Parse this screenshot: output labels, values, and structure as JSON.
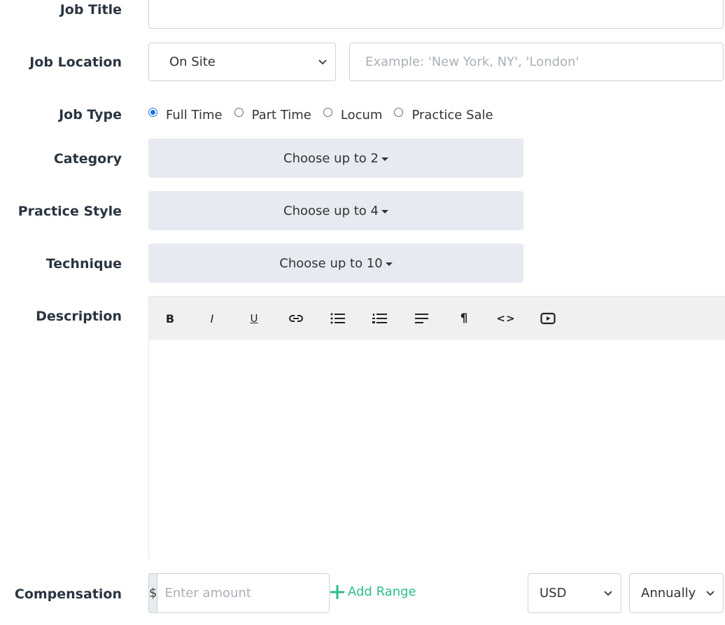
{
  "form": {
    "job_title": {
      "label": "Job Title",
      "value": ""
    },
    "job_location": {
      "label": "Job Location",
      "select_value": "On Site",
      "placeholder": "Example: 'New York, NY', 'London'"
    },
    "job_type": {
      "label": "Job Type",
      "options": [
        {
          "label": "Full Time",
          "checked": true
        },
        {
          "label": "Part Time",
          "checked": false
        },
        {
          "label": "Locum",
          "checked": false
        },
        {
          "label": "Practice Sale",
          "checked": false
        }
      ]
    },
    "category": {
      "label": "Category",
      "button": "Choose up to 2"
    },
    "practice_style": {
      "label": "Practice Style",
      "button": "Choose up to 4"
    },
    "technique": {
      "label": "Technique",
      "button": "Choose up to 10"
    },
    "description": {
      "label": "Description",
      "toolbar": [
        {
          "name": "bold",
          "icon": "bold-icon",
          "glyph": "B"
        },
        {
          "name": "italic",
          "icon": "italic-icon",
          "glyph": "I"
        },
        {
          "name": "underline",
          "icon": "underline-icon",
          "glyph": "U"
        },
        {
          "name": "link",
          "icon": "link-icon"
        },
        {
          "name": "bullet-list",
          "icon": "bullet-list-icon"
        },
        {
          "name": "numbered-list",
          "icon": "numbered-list-icon"
        },
        {
          "name": "align",
          "icon": "align-left-icon"
        },
        {
          "name": "paragraph",
          "icon": "paragraph-icon",
          "glyph": "¶"
        },
        {
          "name": "code",
          "icon": "code-icon",
          "glyph": "<>"
        },
        {
          "name": "video",
          "icon": "video-icon"
        }
      ]
    },
    "compensation": {
      "label": "Compensation",
      "currency_symbol": "$",
      "amount_placeholder": "Enter amount",
      "add_range": "Add Range",
      "currency": "USD",
      "period": "Annually"
    }
  },
  "colors": {
    "accent_green": "#2dbb8f",
    "radio_blue": "#1a73e8",
    "dropdown_bg": "#e8eaf1"
  }
}
